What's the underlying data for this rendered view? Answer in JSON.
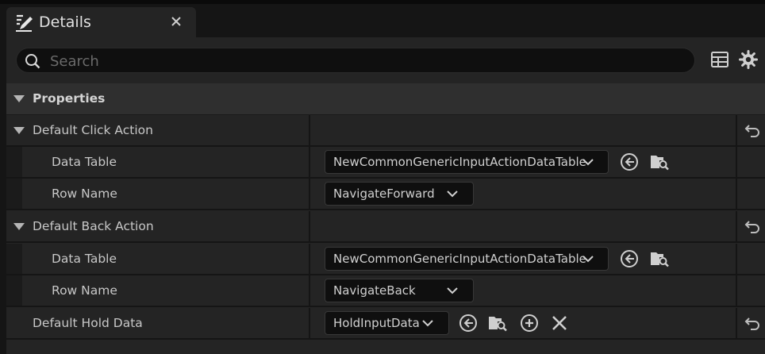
{
  "tab": {
    "title": "Details"
  },
  "search": {
    "placeholder": "Search"
  },
  "category": {
    "label": "Properties"
  },
  "rows": {
    "click_action": {
      "label": "Default Click Action"
    },
    "click_data_table": {
      "label": "Data Table",
      "value": "NewCommonGenericInputActionDataTable"
    },
    "click_row_name": {
      "label": "Row Name",
      "value": "NavigateForward"
    },
    "back_action": {
      "label": "Default Back Action"
    },
    "back_data_table": {
      "label": "Data Table",
      "value": "NewCommonGenericInputActionDataTable"
    },
    "back_row_name": {
      "label": "Row Name",
      "value": "NavigateBack"
    },
    "hold_data": {
      "label": "Default Hold Data",
      "value": "HoldInputData"
    }
  },
  "icons": {
    "tab": "details-pencil-icon",
    "search": "search-icon",
    "table_view": "table-view-icon",
    "settings": "gear-icon",
    "use_selected": "use-selected-asset-icon",
    "browse": "browse-folder-icon",
    "add": "add-icon",
    "clear": "clear-icon",
    "reset": "reset-to-default-icon",
    "dropdown": "chevron-down-icon"
  },
  "colors": {
    "background": "#242424",
    "field": "#0f0f0f",
    "text": "#c8c8c8"
  }
}
